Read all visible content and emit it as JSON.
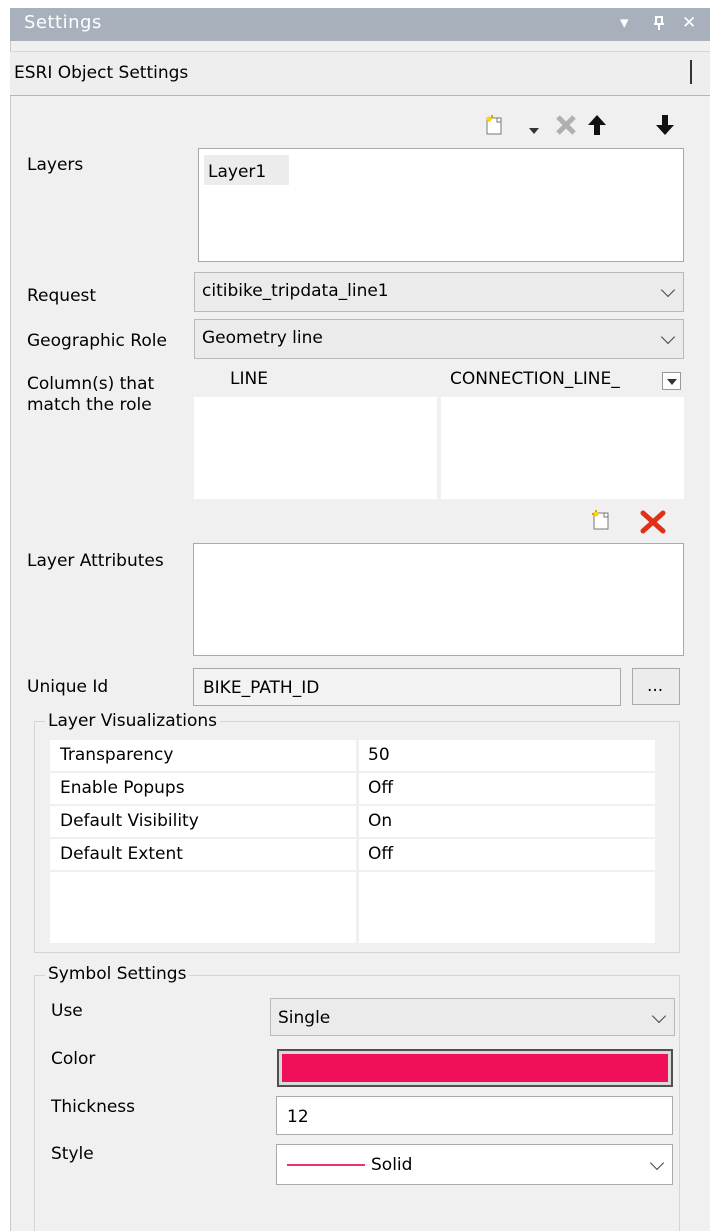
{
  "window": {
    "title": "Settings",
    "controls": {
      "dropdown": "▾",
      "pin": "ᴨ",
      "close": "✕"
    }
  },
  "section_title": "ESRI Object Settings",
  "toolbar_icons": [
    "new-layer-icon",
    "dropdown-arrow-icon",
    "delete-layer-icon",
    "move-up-icon",
    "move-down-icon"
  ],
  "layers": {
    "label": "Layers",
    "items": [
      "Layer1"
    ]
  },
  "request": {
    "label": "Request",
    "value": "citibike_tripdata_line1"
  },
  "geographic_role": {
    "label": "Geographic Role",
    "value": "Geometry line"
  },
  "columns_role": {
    "label_line1": "Column(s) that",
    "label_line2": "match the role",
    "col1": "LINE",
    "col2": "CONNECTION_LINE_"
  },
  "layer_attributes": {
    "label": "Layer Attributes"
  },
  "unique_id": {
    "label": "Unique Id",
    "value": "BIKE_PATH_ID",
    "browse_label": "..."
  },
  "layer_visualizations": {
    "title": "Layer Visualizations",
    "rows": [
      {
        "name": "Transparency",
        "value": "50"
      },
      {
        "name": "Enable Popups",
        "value": "Off"
      },
      {
        "name": "Default Visibility",
        "value": "On"
      },
      {
        "name": "Default Extent",
        "value": "Off"
      }
    ]
  },
  "symbol_settings": {
    "title": "Symbol Settings",
    "use": {
      "label": "Use",
      "value": "Single"
    },
    "color": {
      "label": "Color",
      "value": "#f0105a"
    },
    "thickness": {
      "label": "Thickness",
      "value": "12"
    },
    "style": {
      "label": "Style",
      "value": "Solid",
      "line_color": "#e8337a"
    }
  },
  "colors": {
    "titlebar": "#a7b0bb",
    "delete_red": "#e03018",
    "panel": "#f0f0f0"
  }
}
